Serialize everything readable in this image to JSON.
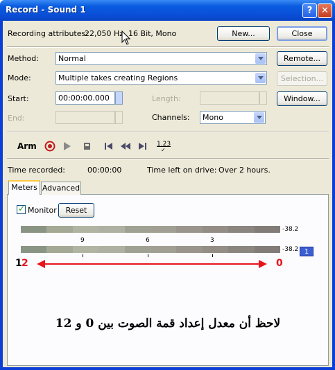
{
  "window": {
    "title": "Record - Sound 1",
    "help_glyph": "?",
    "close_glyph": "✕"
  },
  "attributes": {
    "label": "Recording attributes:",
    "value": "22,050 Hz, 16 Bit, Mono"
  },
  "buttons": {
    "new": "New...",
    "close": "Close",
    "remote": "Remote...",
    "selection": "Selection...",
    "window": "Window...",
    "reset": "Reset"
  },
  "fields": {
    "method_label": "Method:",
    "method_value": "Normal",
    "mode_label": "Mode:",
    "mode_value": "Multiple takes creating Regions",
    "start_label": "Start:",
    "start_value": "00:00:00.000",
    "end_label": "End:",
    "length_label": "Length:",
    "channels_label": "Channels:",
    "channels_value": "Mono"
  },
  "transport": {
    "arm_label": "Arm",
    "counter_label": "1.23"
  },
  "status": {
    "time_recorded_label": "Time recorded:",
    "time_recorded_value": "00:00:00",
    "time_left_label": "Time left on drive:",
    "time_left_value": "Over 2 hours."
  },
  "tabs": [
    {
      "label": "Meters",
      "active": true
    },
    {
      "label": "Advanced",
      "active": false
    }
  ],
  "meters": {
    "monitor_label": "Monitor",
    "monitor_checked": true,
    "level_top": "-38.2",
    "level_bottom": "-38.2",
    "ticks": [
      "9",
      "6",
      "3"
    ],
    "channel_badge": "1"
  },
  "annotation": {
    "left_number_1": "1",
    "left_number_2": "2",
    "right_number": "0",
    "arabic_text": "لاحظ أن معدل إعداد قمة الصوت بين 0 و 12",
    "arrow_color": "#e8141c"
  },
  "colors": {
    "titlebar": "#0a4fd8",
    "dialog_bg": "#ece9d8",
    "button_border": "#003c74",
    "record_red": "#c4191c"
  }
}
